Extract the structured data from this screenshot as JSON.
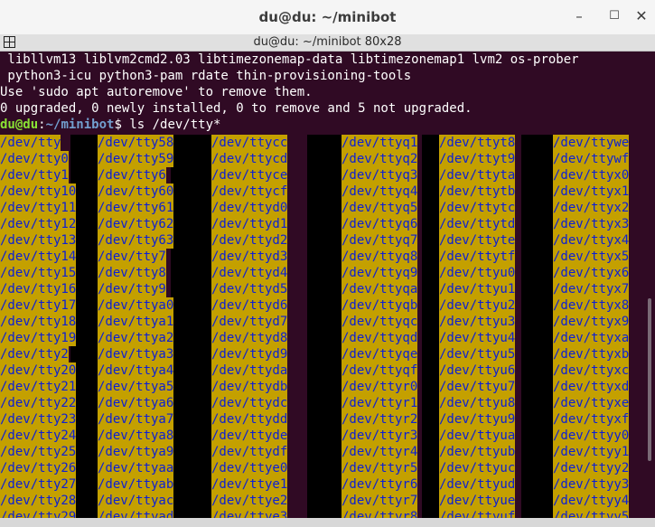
{
  "window": {
    "title": "du@du: ~/minibot",
    "subtitle": "du@du: ~/minibot 80x28",
    "min_symbol": "–",
    "max_symbol": "☐",
    "close_symbol": "✕"
  },
  "terminal": {
    "lines": [
      " libllvm13 liblvm2cmd2.03 libtimezonemap-data libtimezonemap1 lvm2 os-prober",
      " python3-icu python3-pam rdate thin-provisioning-tools",
      "Use 'sudo apt autoremove' to remove them.",
      "0 upgraded, 0 newly installed, 0 to remove and 5 not upgraded."
    ],
    "prompt_user": "du@du",
    "prompt_sep": ":",
    "prompt_path": "~/minibot",
    "prompt_cmd": "$ ls /dev/tty*",
    "listing": [
      [
        "/dev/tty",
        "/dev/tty58",
        "/dev/ttycc",
        "/dev/ttyq1",
        "/dev/ttyt8",
        "/dev/ttywe"
      ],
      [
        "/dev/tty0",
        "/dev/tty59",
        "/dev/ttycd",
        "/dev/ttyq2",
        "/dev/ttyt9",
        "/dev/ttywf"
      ],
      [
        "/dev/tty1",
        "/dev/tty6",
        "/dev/ttyce",
        "/dev/ttyq3",
        "/dev/ttyta",
        "/dev/ttyx0"
      ],
      [
        "/dev/tty10",
        "/dev/tty60",
        "/dev/ttycf",
        "/dev/ttyq4",
        "/dev/ttytb",
        "/dev/ttyx1"
      ],
      [
        "/dev/tty11",
        "/dev/tty61",
        "/dev/ttyd0",
        "/dev/ttyq5",
        "/dev/ttytc",
        "/dev/ttyx2"
      ],
      [
        "/dev/tty12",
        "/dev/tty62",
        "/dev/ttyd1",
        "/dev/ttyq6",
        "/dev/ttytd",
        "/dev/ttyx3"
      ],
      [
        "/dev/tty13",
        "/dev/tty63",
        "/dev/ttyd2",
        "/dev/ttyq7",
        "/dev/ttyte",
        "/dev/ttyx4"
      ],
      [
        "/dev/tty14",
        "/dev/tty7",
        "/dev/ttyd3",
        "/dev/ttyq8",
        "/dev/ttytf",
        "/dev/ttyx5"
      ],
      [
        "/dev/tty15",
        "/dev/tty8",
        "/dev/ttyd4",
        "/dev/ttyq9",
        "/dev/ttyu0",
        "/dev/ttyx6"
      ],
      [
        "/dev/tty16",
        "/dev/tty9",
        "/dev/ttyd5",
        "/dev/ttyqa",
        "/dev/ttyu1",
        "/dev/ttyx7"
      ],
      [
        "/dev/tty17",
        "/dev/ttya0",
        "/dev/ttyd6",
        "/dev/ttyqb",
        "/dev/ttyu2",
        "/dev/ttyx8"
      ],
      [
        "/dev/tty18",
        "/dev/ttya1",
        "/dev/ttyd7",
        "/dev/ttyqc",
        "/dev/ttyu3",
        "/dev/ttyx9"
      ],
      [
        "/dev/tty19",
        "/dev/ttya2",
        "/dev/ttyd8",
        "/dev/ttyqd",
        "/dev/ttyu4",
        "/dev/ttyxa"
      ],
      [
        "/dev/tty2",
        "/dev/ttya3",
        "/dev/ttyd9",
        "/dev/ttyqe",
        "/dev/ttyu5",
        "/dev/ttyxb"
      ],
      [
        "/dev/tty20",
        "/dev/ttya4",
        "/dev/ttyda",
        "/dev/ttyqf",
        "/dev/ttyu6",
        "/dev/ttyxc"
      ],
      [
        "/dev/tty21",
        "/dev/ttya5",
        "/dev/ttydb",
        "/dev/ttyr0",
        "/dev/ttyu7",
        "/dev/ttyxd"
      ],
      [
        "/dev/tty22",
        "/dev/ttya6",
        "/dev/ttydc",
        "/dev/ttyr1",
        "/dev/ttyu8",
        "/dev/ttyxe"
      ],
      [
        "/dev/tty23",
        "/dev/ttya7",
        "/dev/ttydd",
        "/dev/ttyr2",
        "/dev/ttyu9",
        "/dev/ttyxf"
      ],
      [
        "/dev/tty24",
        "/dev/ttya8",
        "/dev/ttyde",
        "/dev/ttyr3",
        "/dev/ttyua",
        "/dev/ttyy0"
      ],
      [
        "/dev/tty25",
        "/dev/ttya9",
        "/dev/ttydf",
        "/dev/ttyr4",
        "/dev/ttyub",
        "/dev/ttyy1"
      ],
      [
        "/dev/tty26",
        "/dev/ttyaa",
        "/dev/ttye0",
        "/dev/ttyr5",
        "/dev/ttyuc",
        "/dev/ttyy2"
      ],
      [
        "/dev/tty27",
        "/dev/ttyab",
        "/dev/ttye1",
        "/dev/ttyr6",
        "/dev/ttyud",
        "/dev/ttyy3"
      ],
      [
        "/dev/tty28",
        "/dev/ttyac",
        "/dev/ttye2",
        "/dev/ttyr7",
        "/dev/ttyue",
        "/dev/ttyy4"
      ],
      [
        "/dev/tty29",
        "/dev/ttyad",
        "/dev/ttye3",
        "/dev/ttyr8",
        "/dev/ttyuf",
        "/dev/ttyy5"
      ]
    ]
  },
  "colors": {
    "background": "#300a24",
    "highlight": "#c4a000",
    "highlight_text": "#0b1fd6",
    "prompt_user": "#8ae234",
    "prompt_path": "#729fcf"
  }
}
